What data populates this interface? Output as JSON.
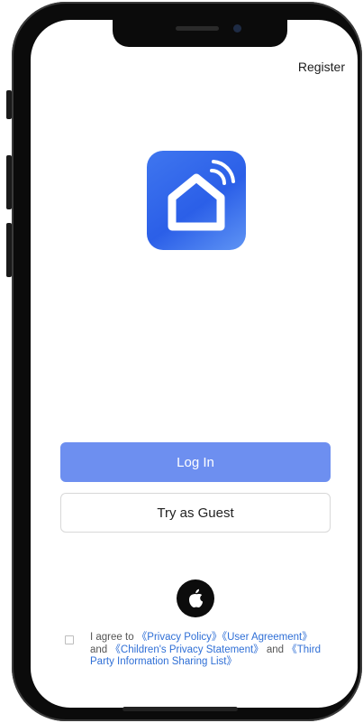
{
  "header": {
    "register_label": "Register"
  },
  "app_logo": {
    "icon": "smart-home-icon",
    "accent": "#3f76ef"
  },
  "buttons": {
    "login_label": "Log In",
    "guest_label": "Try as Guest"
  },
  "social": {
    "apple_icon": "apple-icon"
  },
  "agreement": {
    "prefix": "I agree to ",
    "privacy_policy": "《Privacy Policy》",
    "user_agreement": "《User Agreement》",
    "and1": "and ",
    "children_privacy": "《Children's Privacy Statement》",
    "and2": " and ",
    "third_party": "《Third Party Information Sharing List》"
  },
  "colors": {
    "primary": "#6d8ff0",
    "link": "#2f6fd6",
    "text": "#222222"
  }
}
